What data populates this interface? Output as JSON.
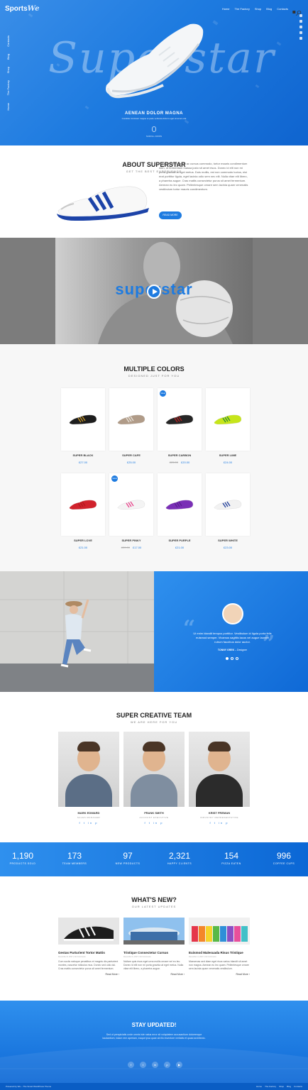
{
  "brand": {
    "name": "Sports",
    "accent": "We"
  },
  "nav": {
    "items": [
      "Home",
      "The Factory",
      "Shop",
      "Blog",
      "Contacts"
    ]
  },
  "side_nav": [
    "Contacts",
    "Blog",
    "Shop",
    "The Factory",
    "Home"
  ],
  "hero": {
    "script": "Superstar",
    "title": "AENEAN DOLOR MAGNA",
    "subtitle": "Curabitur tincidunt magna ut pede vehicula dictum eget sit amet erat",
    "scroll": "SCROLL DOWN"
  },
  "about": {
    "title": "ABOUT SUPERSTAR",
    "subtitle": "GET THE BEST EXPERIENCE",
    "text": "Fusce dapibus, tellus ac cursus commodo, tortor mauris condimentum nibh, ut fermentum massa justo sit amet risus. Donec id elit non mi porta gravida at eget metus. Duis mollis, est non commodo luctus, nisi erat porttitor ligula, eget lacinia odio sem nec elit. Nulla vitae elit libero, a pharetra augue. Cras mattis consectetur purus sit amet fermentum. Aenean eu leo quam. Pellentesque ornare sem lacinia quam venenatis vestibulum tortor mauris condimentum.",
    "button": "READ MORE"
  },
  "video": {
    "overlay_text": "superstar"
  },
  "products": {
    "title": "MULTIPLE COLORS",
    "subtitle": "DESIGNED JUST FOR YOU",
    "items": [
      {
        "name": "SUPER BLACK",
        "price": "£27.00",
        "old_price": "",
        "badge": "",
        "color": "#1d1d1d",
        "stripe": "#c9982a"
      },
      {
        "name": "SUPER CAFE",
        "price": "£25.00",
        "old_price": "",
        "badge": "",
        "color": "#b09b88",
        "stripe": "#e8e2d8"
      },
      {
        "name": "SUPER CARBON",
        "price": "£20.00",
        "old_price": "£25.00",
        "badge": "SALE",
        "color": "#262626",
        "stripe": "#b52020"
      },
      {
        "name": "SUPER LIME",
        "price": "£24.00",
        "old_price": "",
        "badge": "",
        "color": "#c6e51a",
        "stripe": "#2a8a38"
      },
      {
        "name": "SUPER LOVE",
        "price": "£21.00",
        "old_price": "",
        "badge": "",
        "color": "#d1222c",
        "stripe": "#b31820"
      },
      {
        "name": "SUPER PINKY",
        "price": "£17.00",
        "old_price": "£20.00",
        "badge": "SALE",
        "color": "#f4f4f4",
        "stripe": "#e9418a"
      },
      {
        "name": "SUPER PURPLE",
        "price": "£21.00",
        "old_price": "",
        "badge": "",
        "color": "#7a2fb6",
        "stripe": "#5b1e90"
      },
      {
        "name": "SUPER WHITE",
        "price": "£23.00",
        "old_price": "",
        "badge": "",
        "color": "#f2f2f2",
        "stripe": "#1e3c9a"
      }
    ]
  },
  "testimonial": {
    "text": "Ut enim blandit tempus porttitor. Vestibulum id ligula porta felis euismod semper. Vivamus sagittis lacus vel augue laoreet rutrum faucibus dolor auctor.",
    "author": "TONNY GREK",
    "author_role": "Designer"
  },
  "team": {
    "title": "SUPER CREATIVE TEAM",
    "subtitle": "WE ARE HERE FOR YOU",
    "members": [
      {
        "name": "MARK EDWARD",
        "role": "SALES MANAGER",
        "shirt": "#5b6e86"
      },
      {
        "name": "FRANK SMITH",
        "role": "ACCOUNT EXECUTIVE",
        "shirt": "#7f8ea0"
      },
      {
        "name": "KRIST FREMAN",
        "role": "INDUSTRY REPRESENTATIVE",
        "shirt": "#2b2b2b"
      }
    ],
    "social_icons": "f  t  in  p"
  },
  "stats": [
    {
      "num": "1,190",
      "label": "PRODUCTS SOLD"
    },
    {
      "num": "173",
      "label": "TEAM MEMBERS"
    },
    {
      "num": "97",
      "label": "NEW PRODUCTS"
    },
    {
      "num": "2,321",
      "label": "HAPPY CLIENTS"
    },
    {
      "num": "154",
      "label": "PIZZA EATEN"
    },
    {
      "num": "996",
      "label": "COFFEE CUPS"
    }
  ],
  "news": {
    "title": "WHAT'S NEW?",
    "subtitle": "OUR LATEST UPDATES",
    "posts": [
      {
        "title": "Gestas Parturient Tortor Mattis",
        "meta": "December 8, 2017 | No Comments",
        "excerpt": "Cum sociis natoque penatibus et magnis dis parturient montes, nascetur ridiculus mus. Donec sed odio dui. Cras mattis consectetur purus sit amet fermentum.",
        "more": "Read More ›"
      },
      {
        "title": "Tristique Consectetur Cursus",
        "meta": "December 6, 2017 | No Comments",
        "excerpt": "Nullam quis risus eget urna mollis ornare vel eu leo. Donec id elit non mi porta gravida at eget metus. Nulla vitae elit libero, a pharetra augue.",
        "more": "Read More ›"
      },
      {
        "title": "Euismod Malesuada Risus Tristique",
        "meta": "December 4, 2017 | No Comments",
        "excerpt": "Maecenas sed diam eget risus varius blandit sit amet non magna. Aenean eu leo quam. Pellentesque ornare sem lacinia quam venenatis vestibulum.",
        "more": "Read More ›"
      }
    ]
  },
  "newsletter": {
    "title": "STAY UPDATED!",
    "text": "Sed ut perspiciatis unde omnis iste natus error sit voluptatem accusantium doloremque laudantium, totam rem aperiam, eaque ipsa quae ab illo inventore veritatis et quasi architecto."
  },
  "footer": {
    "copy": "Powered by We – The Smart WordPress Theme",
    "links": [
      "Home",
      "The Factory",
      "Shop",
      "Blog",
      "Contacts"
    ]
  },
  "colors": {
    "accent": "#1e7be0",
    "hero_gradient_start": "#3a8ee8",
    "hero_gradient_end": "#0f64cf"
  }
}
